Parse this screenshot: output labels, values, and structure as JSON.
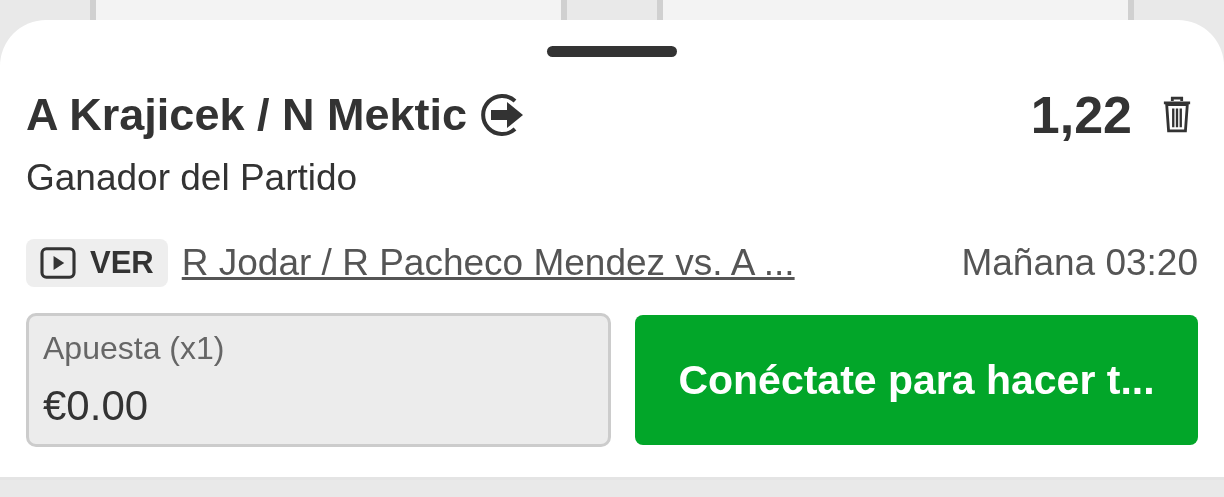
{
  "selection": {
    "name": "A Krajicek / N Mektic",
    "odds": "1,22",
    "market": "Ganador del Partido"
  },
  "event": {
    "watch_label": "VER",
    "title": "R Jodar / R Pacheco Mendez vs. A ...",
    "time": "Mañana 03:20"
  },
  "stake": {
    "label": "Apuesta (x1)",
    "value": "€0.00"
  },
  "login_button": "Conéctate para hacer t..."
}
